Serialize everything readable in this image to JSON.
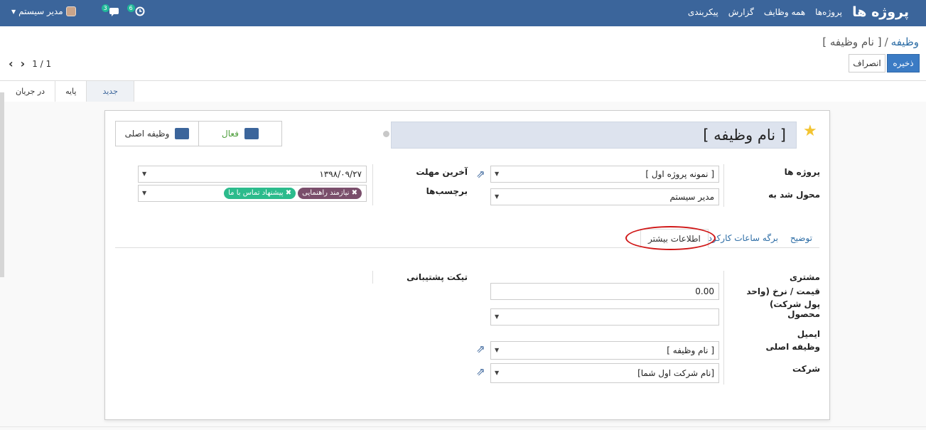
{
  "navbar": {
    "brand": "پروژه ها",
    "menu": [
      "پروژه‌ها",
      "همه وظایف",
      "گزارش",
      "پیکربندی"
    ],
    "messages_badge": "3",
    "activity_badge": "6",
    "user_name": "مدیر سیستم"
  },
  "breadcrumb": {
    "parent": "وظیفه",
    "separator": "/",
    "current": "[ نام وظیفه ]"
  },
  "actions": {
    "save": "ذخیره",
    "discard": "انصراف"
  },
  "pager": {
    "value": "1 / 1"
  },
  "stages": [
    "جدید",
    "پایه",
    "در جریان"
  ],
  "active_stage": "جدید",
  "smart_buttons": {
    "active_label": "فعال",
    "parent_task_label": "وظیفه اصلی"
  },
  "form": {
    "task_name": "[ نام وظیفه ]",
    "project_label": "پروژه ها",
    "project_value": "[ نمونه پروژه اول ]",
    "assigned_label": "محول شد به",
    "assigned_value": "مدیر سیستم",
    "deadline_label": "آخرین مهلت",
    "deadline_value": "۱۳۹۸/۰۹/۲۷",
    "tags_label": "برچسب‌ها",
    "tags": [
      {
        "name": "نیازمند راهنمایی",
        "color": "#7a4e6b"
      },
      {
        "name": "پیشنهاد تماس با ما",
        "color": "#2cbb8c"
      }
    ]
  },
  "tabs": {
    "description": "توضیح",
    "timesheets": "برگه ساعات کارکرد",
    "extra_info": "اطلاعات بیشتر",
    "active": "اطلاعات بیشتر"
  },
  "extra": {
    "customer_label": "مشتری",
    "price_label": "قیمت / نرخ (واحد پول شرکت)",
    "price_value": "0.00",
    "product_label": "محصول",
    "email_label": "ایمیل",
    "parent_label": "وظیفه اصلی",
    "parent_value": "[ نام وظیفه ]",
    "company_label": "شرکت",
    "company_value": "[نام شرکت اول شما]",
    "ticket_label": "تیکت پشتیبانی"
  },
  "colors": {
    "navbar": "#3b659b",
    "primary": "#3b7bc4",
    "highlight": "#d01717",
    "star": "#f3c431"
  }
}
